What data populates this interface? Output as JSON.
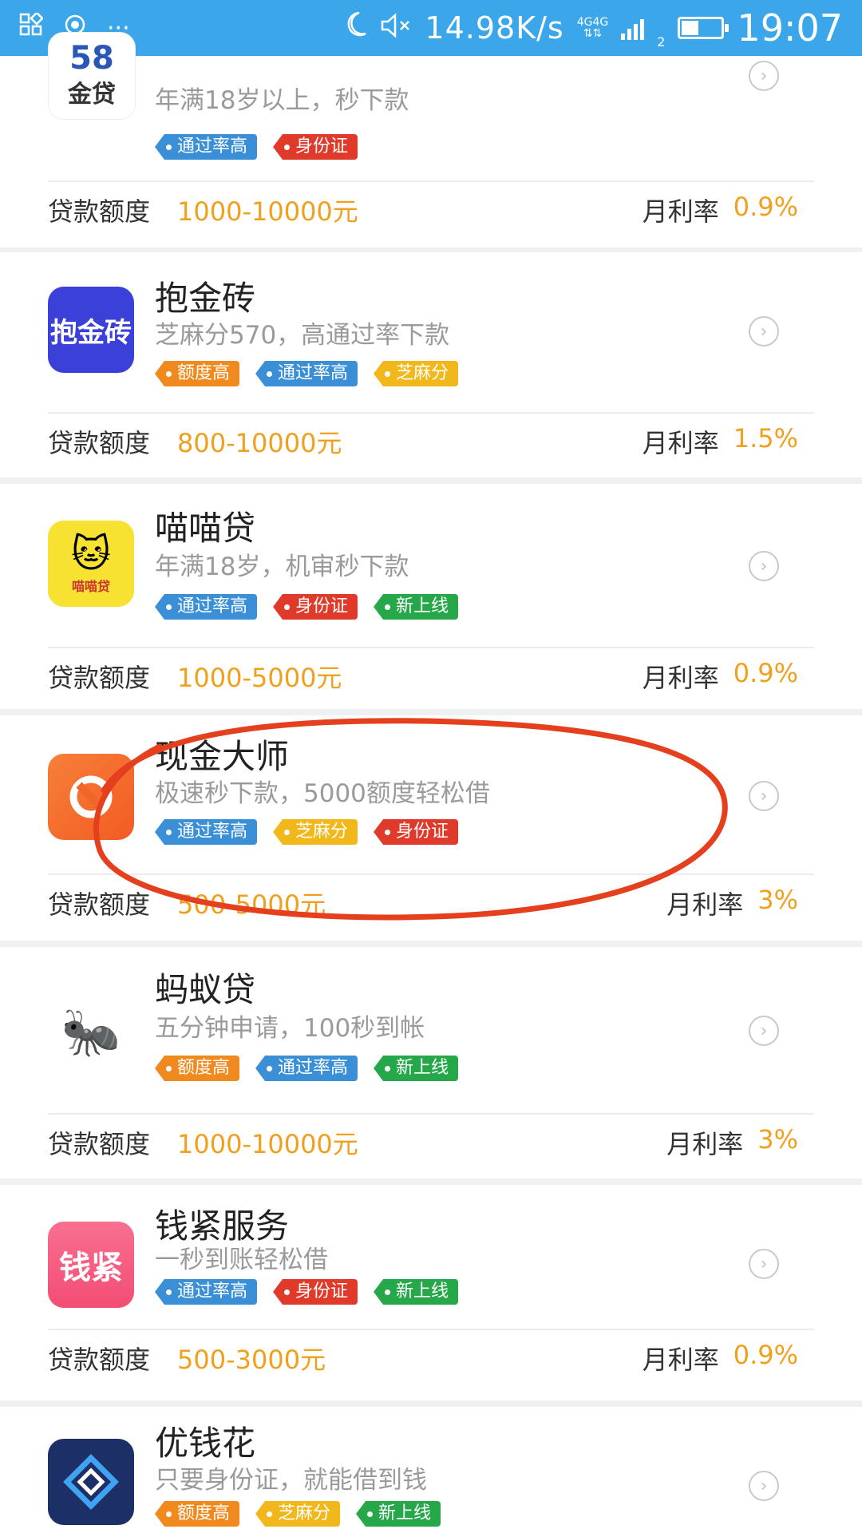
{
  "status_bar": {
    "speed": "14.98K/s",
    "net_label": "4G4G",
    "sim": "2",
    "time": "19:07"
  },
  "labels": {
    "amount": "贷款额度",
    "rate": "月利率"
  },
  "colors": {
    "status_bar": "#3ba7ea",
    "accent_value": "#f0a01c",
    "tag_blue": "#3a8fd6",
    "tag_red": "#e03a2a",
    "tag_orange": "#f08a1e",
    "tag_yellow": "#f2b81b",
    "tag_green": "#26a84a",
    "annotation": "#e5401e"
  },
  "loans": [
    {
      "name": "",
      "logo_text": "金贷",
      "logo_number": "58",
      "desc": "年满18岁以上，秒下款",
      "tags": [
        "通过率高",
        "身份证"
      ],
      "amount": "1000-10000元",
      "rate": "0.9%"
    },
    {
      "name": "抱金砖",
      "logo_text": "抱金砖",
      "desc": "芝麻分570，高通过率下款",
      "tags": [
        "额度高",
        "通过率高",
        "芝麻分"
      ],
      "amount": "800-10000元",
      "rate": "1.5%"
    },
    {
      "name": "喵喵贷",
      "logo_text": "喵喵贷",
      "desc": "年满18岁，机审秒下款",
      "tags": [
        "通过率高",
        "身份证",
        "新上线"
      ],
      "amount": "1000-5000元",
      "rate": "0.9%"
    },
    {
      "name": "现金大师",
      "desc": "极速秒下款，5000额度轻松借",
      "tags": [
        "通过率高",
        "芝麻分",
        "身份证"
      ],
      "amount": "500-5000元",
      "rate": "3%"
    },
    {
      "name": "蚂蚁贷",
      "desc": "五分钟申请，100秒到帐",
      "tags": [
        "额度高",
        "通过率高",
        "新上线"
      ],
      "amount": "1000-10000元",
      "rate": "3%"
    },
    {
      "name": "钱紧服务",
      "logo_text": "钱紧",
      "desc": "一秒到账轻松借",
      "tags": [
        "通过率高",
        "身份证",
        "新上线"
      ],
      "amount": "500-3000元",
      "rate": "0.9%"
    },
    {
      "name": "优钱花",
      "desc": "只要身份证，就能借到钱",
      "tags": [
        "额度高",
        "芝麻分",
        "新上线"
      ],
      "amount": "",
      "rate": ""
    }
  ]
}
